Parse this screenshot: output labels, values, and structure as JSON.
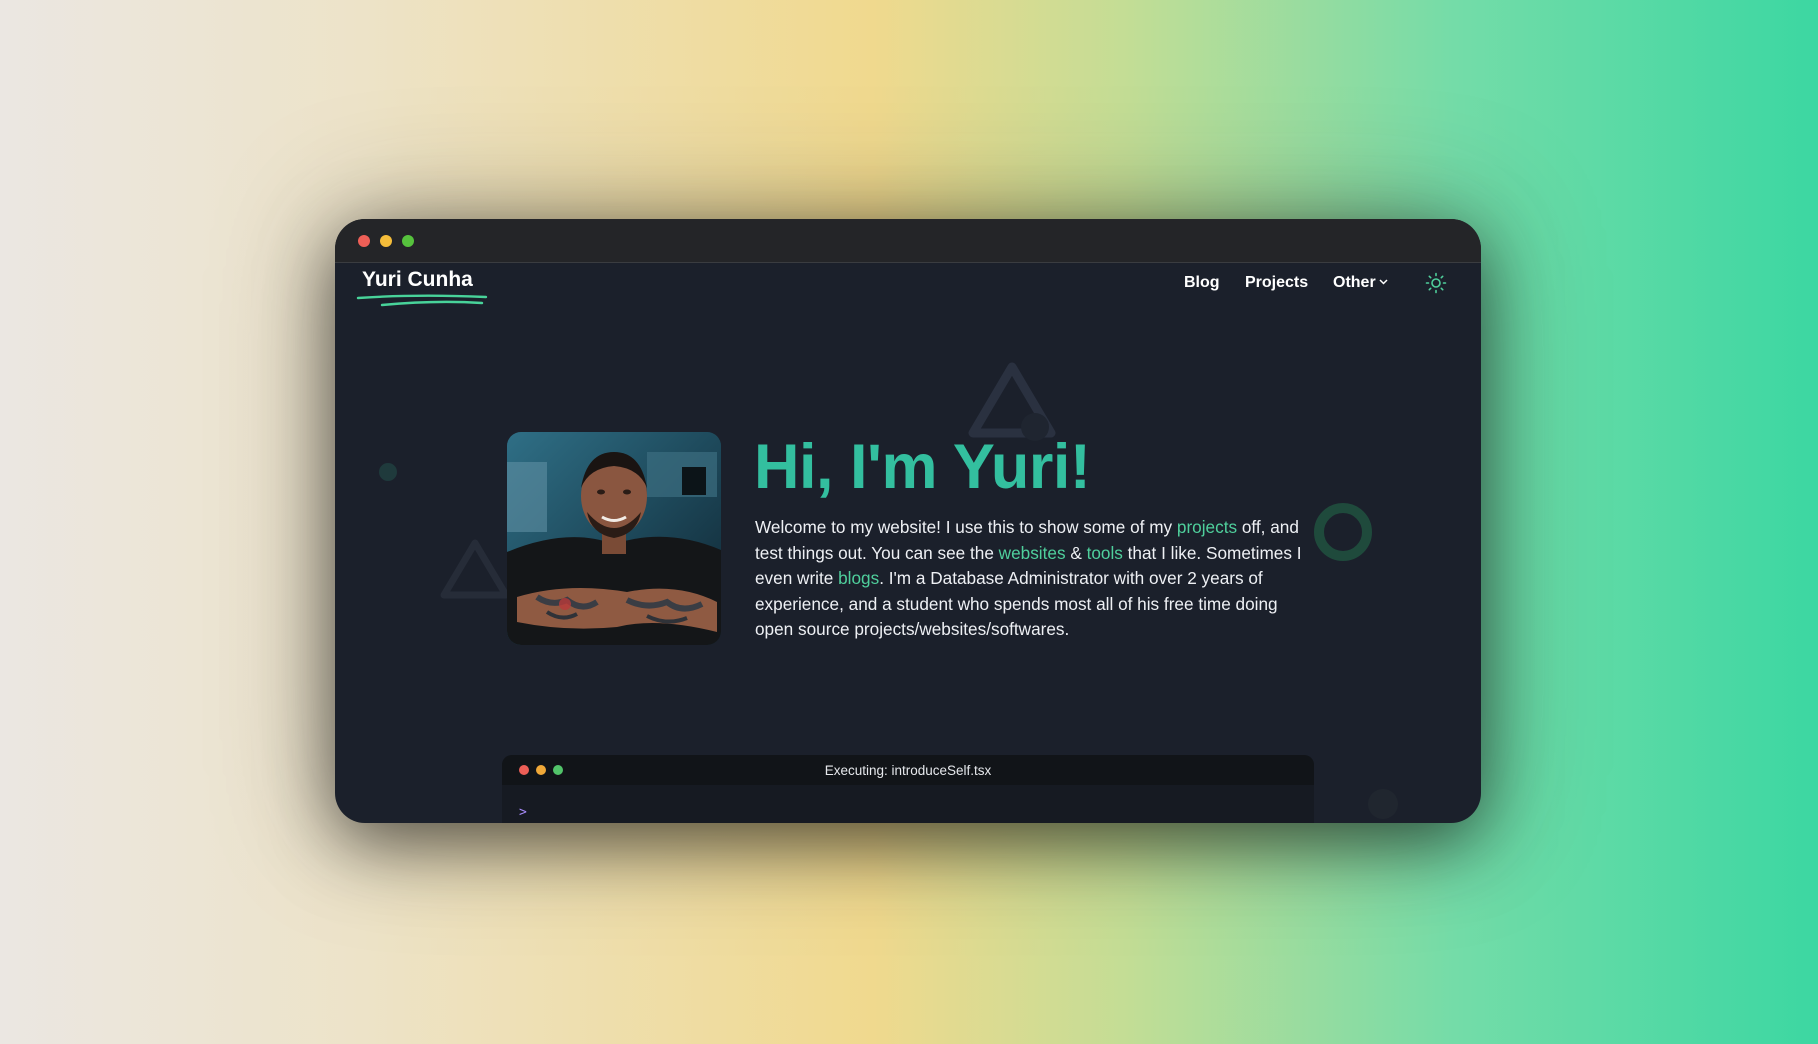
{
  "window": {
    "controls": [
      "close",
      "minimize",
      "maximize"
    ]
  },
  "header": {
    "brand": "Yuri Cunha",
    "nav": {
      "blog": "Blog",
      "projects": "Projects",
      "other": "Other"
    },
    "theme_toggle_icon": "sun-icon"
  },
  "hero": {
    "title": "Hi, I'm Yuri!",
    "avatar_icon": "profile-photo",
    "intro": {
      "t1": "Welcome to my website! I use this to show some of my ",
      "link_projects": "projects",
      "t2": " off, and test things out. You can see the ",
      "link_websites": "websites",
      "t3": " & ",
      "link_tools": "tools",
      "t4": " that I like. Sometimes I even write ",
      "link_blogs": "blogs",
      "t5": ". I'm a Database Administrator with over 2 years of experience, and a student who spends most all of his free time doing open source projects/websites/softwares."
    }
  },
  "terminal": {
    "title": "Executing: introduceSelf.tsx",
    "prompt": ">"
  },
  "colors": {
    "accent": "#33bf9f",
    "link": "#4fcf9c",
    "background": "#1b202b",
    "prompt": "#a78bfa"
  }
}
